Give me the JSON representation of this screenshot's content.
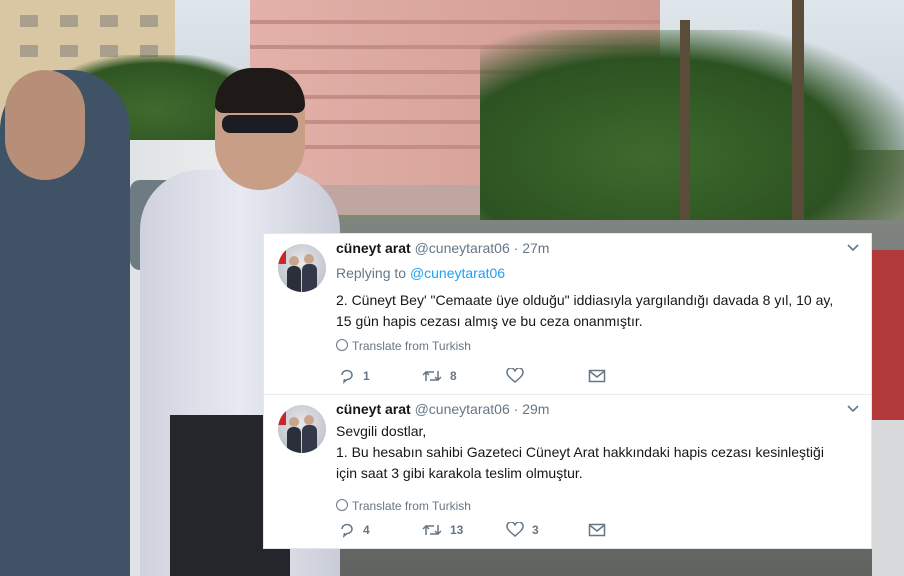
{
  "tweets": [
    {
      "name": "cüneyt arat",
      "handle": "@cuneytarat06",
      "separator": "·",
      "time": "27m",
      "replying_prefix": "Replying to",
      "replying_handle": "@cuneytarat06",
      "lines": [
        "2. Cüneyt Bey' \"Cemaate üye olduğu\" iddiasıyla yargılandığı davada 8 yıl, 10 ay,",
        "15 gün hapis cezası almış ve bu ceza onanmıştır."
      ],
      "translate": "Translate from Turkish",
      "replies": "1",
      "retweets": "8",
      "likes": ""
    },
    {
      "name": "cüneyt arat",
      "handle": "@cuneytarat06",
      "separator": "·",
      "time": "29m",
      "lines": [
        "Sevgili dostlar,",
        "1. Bu hesabın sahibi Gazeteci Cüneyt Arat hakkındaki hapis cezası kesinleştiği",
        "için saat 3 gibi karakola teslim olmuştur."
      ],
      "translate": "Translate from Turkish",
      "replies": "4",
      "retweets": "13",
      "likes": "3"
    }
  ],
  "icons": {
    "reply": "reply-icon",
    "retweet": "retweet-icon",
    "like": "heart-icon",
    "dm": "envelope-icon",
    "menu": "chevron-down-icon",
    "translate": "globe-icon"
  },
  "colors": {
    "accent": "#1da1f2",
    "text": "#14171a",
    "muted": "#657786"
  }
}
